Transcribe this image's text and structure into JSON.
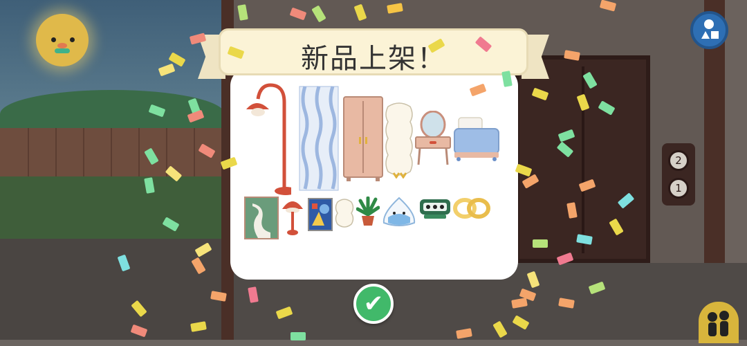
{
  "popup": {
    "title": "新品上架！",
    "confirm_icon": "checkmark-icon"
  },
  "elevator": {
    "floors": [
      "2",
      "1"
    ]
  },
  "hud": {
    "shapes_icon": "shapes-icon",
    "characters_icon": "characters-icon"
  },
  "items": [
    "floor-lamp-icon",
    "curtain-icon",
    "wardrobe-icon",
    "pillow-icon",
    "vanity-table-icon",
    "bed-icon",
    "painting-green-icon",
    "table-lamp-icon",
    "painting-abstract-icon",
    "small-pillow-icon",
    "potted-plant-icon",
    "rice-ball-plush-icon",
    "alarm-clock-icon",
    "knot-cushion-icon"
  ],
  "colors": {
    "banner": "#fbf3d6",
    "confirm": "#41b96a",
    "modal": "#ffffff"
  }
}
